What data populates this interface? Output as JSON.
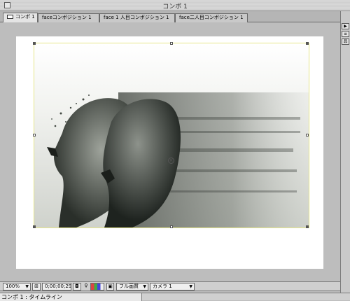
{
  "window": {
    "title": "コンポ 1"
  },
  "tabs": [
    {
      "label": "コンポ 1",
      "active": true
    },
    {
      "label": "faceコンポジション 1",
      "active": false
    },
    {
      "label": "face 1 人目コンポジション 1",
      "active": false
    },
    {
      "label": "face二人目コンポジション 1",
      "active": false
    }
  ],
  "status": {
    "zoom": "100%",
    "timecode": "0;00;00;29",
    "quality": "フル画質",
    "view": "カメラ 1"
  },
  "timeline": {
    "title": "コンポ 1 : タイムライン"
  },
  "colors": {
    "canvas": "#ffffff",
    "pasteboard": "#bdbdbd",
    "layer_outline": "#e6e68a"
  },
  "icons": [
    "close-box-icon",
    "comp-icon",
    "arrow-right-icon",
    "menu-icon",
    "flowchart-icon",
    "region-icon",
    "mask-icon",
    "channel-icon",
    "resolution-icon"
  ]
}
